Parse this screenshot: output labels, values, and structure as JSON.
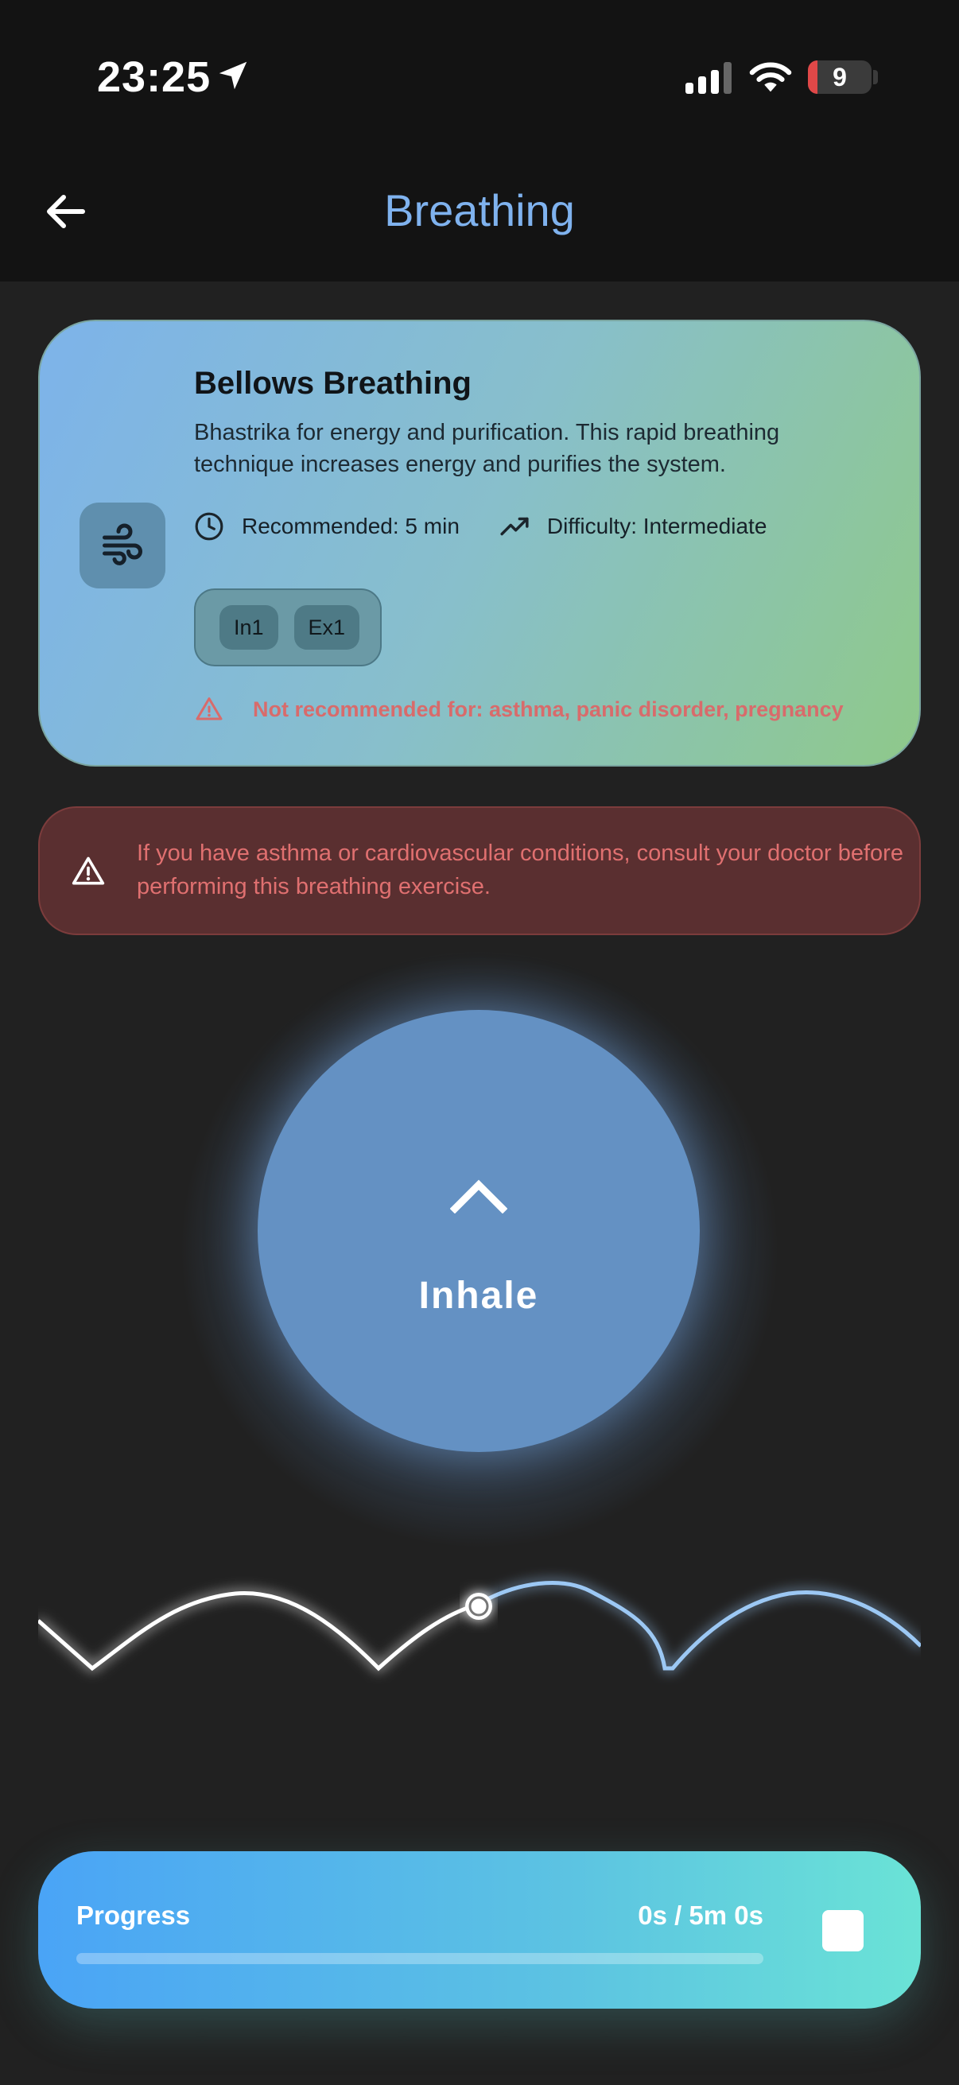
{
  "status_bar": {
    "time": "23:25",
    "battery": "9",
    "icons": [
      "location-arrow-icon",
      "cellular-signal-icon",
      "wifi-icon",
      "battery-icon"
    ]
  },
  "header": {
    "title": "Breathing",
    "back_icon": "arrow-left-icon"
  },
  "exercise": {
    "icon": "wind-icon",
    "title": "Bellows Breathing",
    "description": "Bhastrika for energy and purification. This rapid breathing technique increases energy and purifies the system.",
    "recommended": "Recommended: 5 min",
    "difficulty": "Difficulty: Intermediate",
    "tags": [
      "In1",
      "Ex1"
    ],
    "contraindications": "Not recommended for: asthma, panic disorder, pregnancy"
  },
  "caution": {
    "text": "If you have asthma or cardiovascular conditions, consult your doctor before performing this breathing exercise."
  },
  "breath": {
    "phase": "Inhale",
    "icon": "chevron-up-icon"
  },
  "progress": {
    "label": "Progress",
    "time": "0s / 5m 0s",
    "fraction": 0
  },
  "colors": {
    "accent": "#7fb2ee",
    "warning": "#d86b6b",
    "circle": "#6491c3"
  }
}
